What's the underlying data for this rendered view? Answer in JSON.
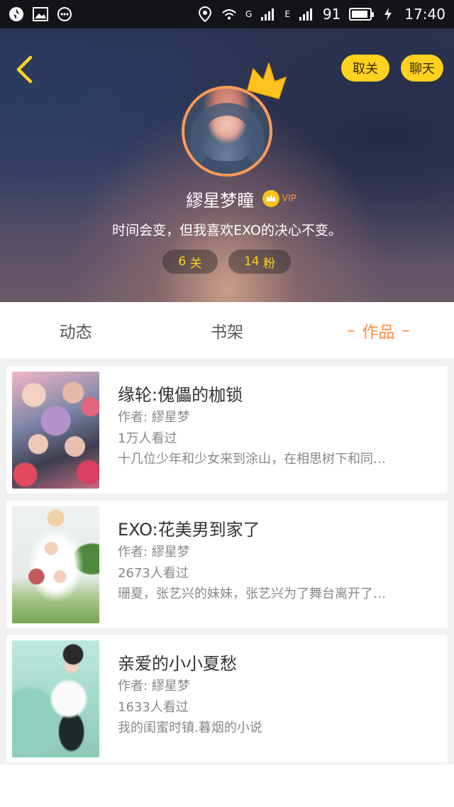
{
  "status_bar": {
    "network_g": "G",
    "network_e": "E",
    "battery_level": "91",
    "time": "17:40",
    "icons": [
      "sync-icon",
      "image-icon",
      "message-icon",
      "location-icon",
      "wifi-icon",
      "signal-icon",
      "battery-icon",
      "charging-icon"
    ]
  },
  "header": {
    "back_icon": "chevron-left-icon",
    "unfollow_label": "取关",
    "chat_label": "聊天",
    "username": "繆星梦瞳",
    "vip_label": "VIP",
    "signature": "时间会变，但我喜欢EXO的决心不变。",
    "following_count": "6",
    "following_label": "关",
    "fans_count": "14",
    "fans_label": "粉",
    "accent_color": "#ffd21f",
    "avatar_border_color": "#ff9a58"
  },
  "tabs": [
    {
      "label": "动态",
      "active": false
    },
    {
      "label": "书架",
      "active": false
    },
    {
      "label": "作品",
      "active": true
    }
  ],
  "tab_active_color": "#ff8b3d",
  "works": [
    {
      "title": "缘轮:傀儡的枷锁",
      "author": "作者: 繆星梦",
      "views": "1万人看过",
      "description": "十几位少年和少女来到涂山，在相思树下和同…"
    },
    {
      "title": "EXO:花美男到家了",
      "author": "作者: 繆星梦",
      "views": "2673人看过",
      "description": "珊夏，张艺兴的妹妹，张艺兴为了舞台离开了…"
    },
    {
      "title": "亲爱的小小夏愁",
      "author": "作者: 繆星梦",
      "views": "1633人看过",
      "description": "我的闺蜜时镇.暮烟的小说"
    }
  ]
}
